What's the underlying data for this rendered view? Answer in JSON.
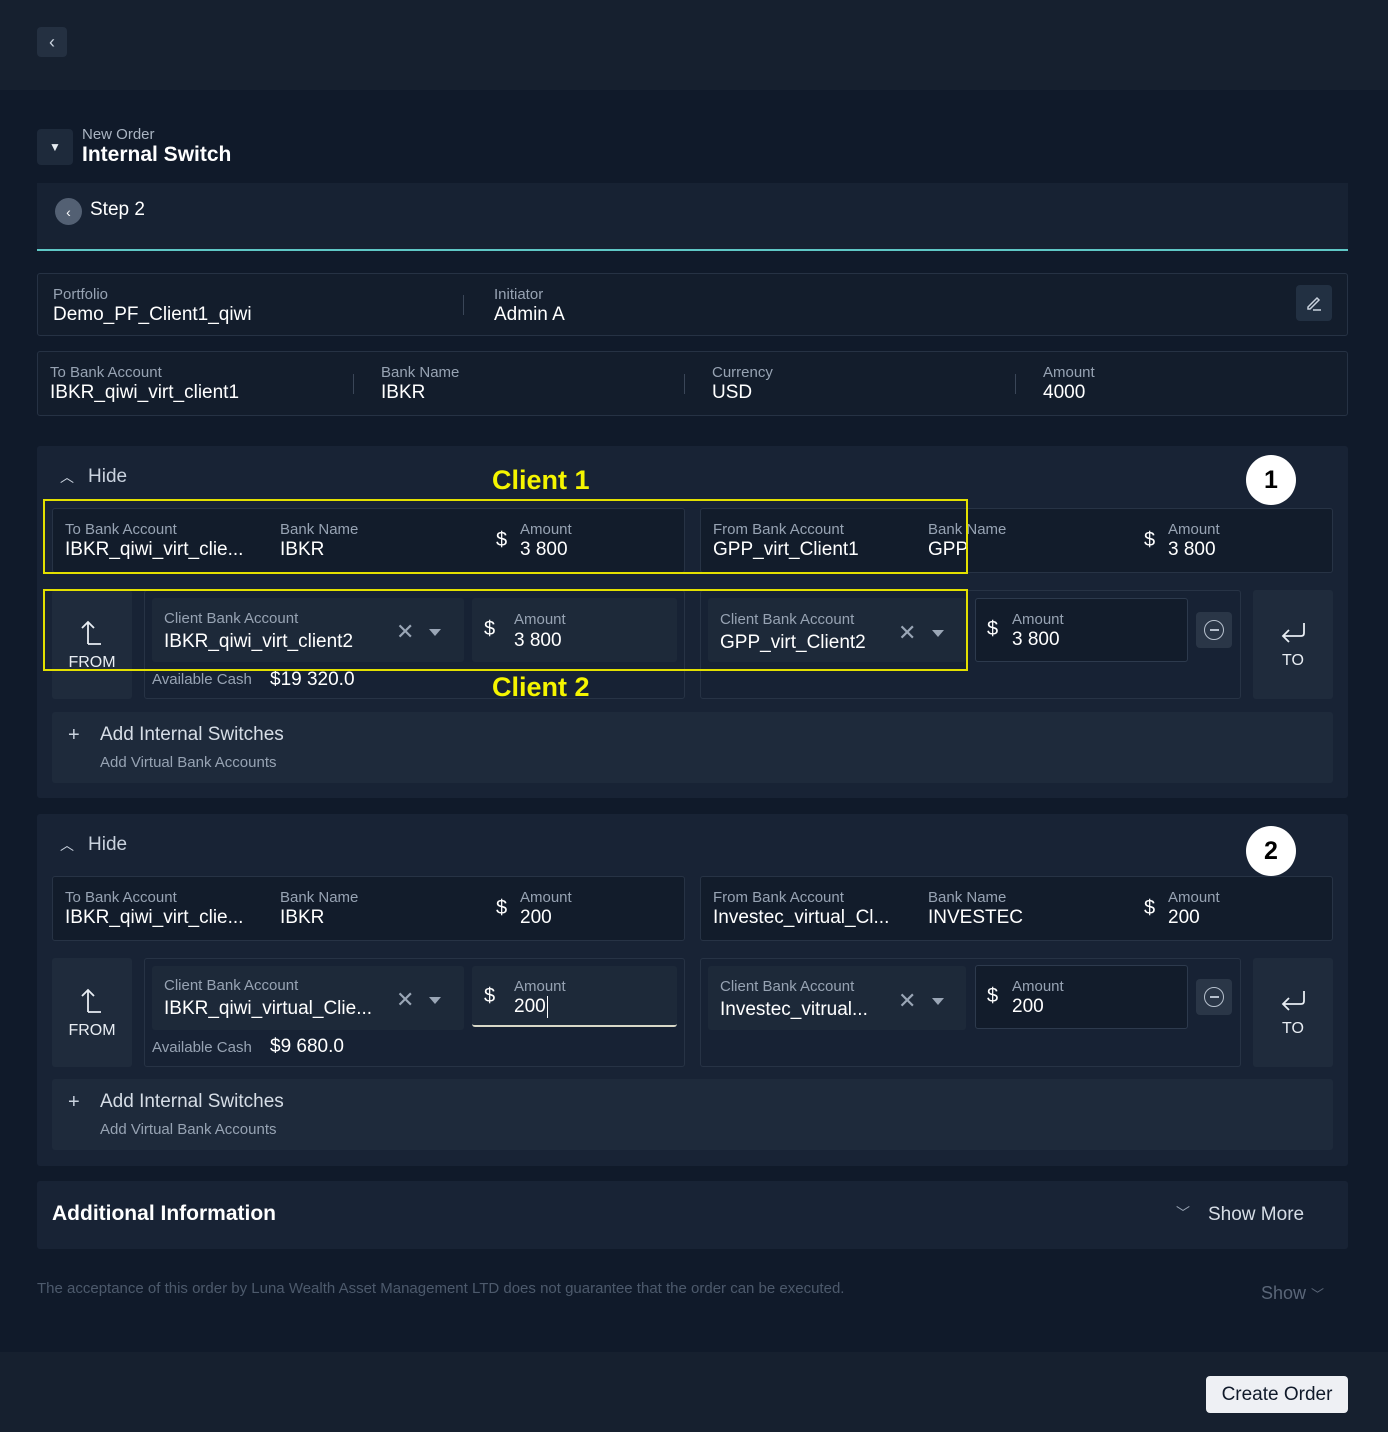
{
  "header": {
    "kicker": "New Order",
    "title": "Internal Switch",
    "step": "Step 2"
  },
  "portfolio": {
    "label": "Portfolio",
    "value": "Demo_PF_Client1_qiwi",
    "initiator_label": "Initiator",
    "initiator": "Admin A"
  },
  "target": {
    "to_bank_label": "To Bank Account",
    "to_bank": "IBKR_qiwi_virt_client1",
    "bank_name_label": "Bank Name",
    "bank_name": "IBKR",
    "currency_label": "Currency",
    "currency": "USD",
    "amount_label": "Amount",
    "amount": "4000"
  },
  "currency_symbol": "$",
  "switches": [
    {
      "hide_label": "Hide",
      "badge": "1",
      "summary_left": {
        "to_label": "To Bank Account",
        "to": "IBKR_qiwi_virt_clie...",
        "bank_label": "Bank Name",
        "bank": "IBKR",
        "amount_label": "Amount",
        "amount": "3 800"
      },
      "summary_right": {
        "from_label": "From Bank Account",
        "from": "GPP_virt_Client1",
        "bank_label": "Bank Name",
        "bank": "GPP",
        "amount_label": "Amount",
        "amount": "3 800"
      },
      "from_label": "FROM",
      "client_left": {
        "label": "Client Bank Account",
        "value": "IBKR_qiwi_virt_client2",
        "amount_label": "Amount",
        "amount": "3 800",
        "avail_label": "Available Cash",
        "avail": "$19 320.0"
      },
      "client_right": {
        "label": "Client Bank Account",
        "value": "GPP_virt_Client2",
        "amount_label": "Amount",
        "amount": "3 800"
      },
      "to_label": "TO",
      "add_title": "Add Internal Switches",
      "add_sub": "Add Virtual Bank Accounts"
    },
    {
      "hide_label": "Hide",
      "badge": "2",
      "summary_left": {
        "to_label": "To Bank Account",
        "to": "IBKR_qiwi_virt_clie...",
        "bank_label": "Bank Name",
        "bank": "IBKR",
        "amount_label": "Amount",
        "amount": "200"
      },
      "summary_right": {
        "from_label": "From Bank Account",
        "from": "Investec_virtual_Cl...",
        "bank_label": "Bank Name",
        "bank": "INVESTEC",
        "amount_label": "Amount",
        "amount": "200"
      },
      "from_label": "FROM",
      "client_left": {
        "label": "Client Bank Account",
        "value": "IBKR_qiwi_virtual_Clie...",
        "amount_label": "Amount",
        "amount": "200",
        "avail_label": "Available Cash",
        "avail": "$9 680.0"
      },
      "client_right": {
        "label": "Client Bank Account",
        "value": "Investec_vitrual...",
        "amount_label": "Amount",
        "amount": "200"
      },
      "to_label": "TO",
      "add_title": "Add Internal Switches",
      "add_sub": "Add Virtual Bank Accounts"
    }
  ],
  "annotations": {
    "client1": "Client 1",
    "client2": "Client 2"
  },
  "additional": {
    "title": "Additional Information",
    "show_more": "Show More"
  },
  "footer": {
    "disclaimer": "The acceptance of this order by Luna Wealth Asset Management LTD does not guarantee that the order can be executed.",
    "show": "Show",
    "create": "Create Order"
  },
  "colors": {
    "accent": "#5fc8c6",
    "annotation": "#f5f500",
    "background": "#101a2a"
  }
}
